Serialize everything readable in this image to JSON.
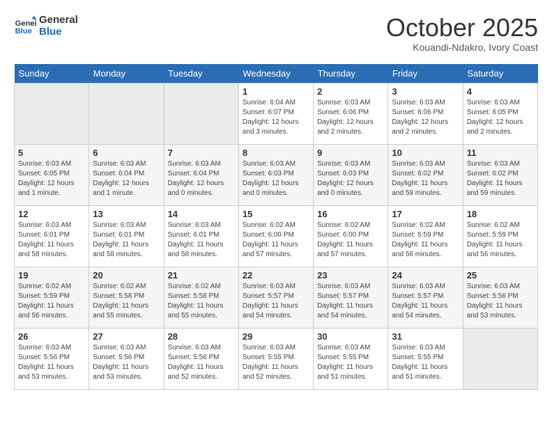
{
  "logo": {
    "line1": "General",
    "line2": "Blue"
  },
  "title": "October 2025",
  "location": "Kouandi-Ndakro, Ivory Coast",
  "days_header": [
    "Sunday",
    "Monday",
    "Tuesday",
    "Wednesday",
    "Thursday",
    "Friday",
    "Saturday"
  ],
  "weeks": [
    [
      {
        "day": "",
        "detail": ""
      },
      {
        "day": "",
        "detail": ""
      },
      {
        "day": "",
        "detail": ""
      },
      {
        "day": "1",
        "detail": "Sunrise: 6:04 AM\nSunset: 6:07 PM\nDaylight: 12 hours\nand 3 minutes."
      },
      {
        "day": "2",
        "detail": "Sunrise: 6:03 AM\nSunset: 6:06 PM\nDaylight: 12 hours\nand 2 minutes."
      },
      {
        "day": "3",
        "detail": "Sunrise: 6:03 AM\nSunset: 6:06 PM\nDaylight: 12 hours\nand 2 minutes."
      },
      {
        "day": "4",
        "detail": "Sunrise: 6:03 AM\nSunset: 6:05 PM\nDaylight: 12 hours\nand 2 minutes."
      }
    ],
    [
      {
        "day": "5",
        "detail": "Sunrise: 6:03 AM\nSunset: 6:05 PM\nDaylight: 12 hours\nand 1 minute."
      },
      {
        "day": "6",
        "detail": "Sunrise: 6:03 AM\nSunset: 6:04 PM\nDaylight: 12 hours\nand 1 minute."
      },
      {
        "day": "7",
        "detail": "Sunrise: 6:03 AM\nSunset: 6:04 PM\nDaylight: 12 hours\nand 0 minutes."
      },
      {
        "day": "8",
        "detail": "Sunrise: 6:03 AM\nSunset: 6:03 PM\nDaylight: 12 hours\nand 0 minutes."
      },
      {
        "day": "9",
        "detail": "Sunrise: 6:03 AM\nSunset: 6:03 PM\nDaylight: 12 hours\nand 0 minutes."
      },
      {
        "day": "10",
        "detail": "Sunrise: 6:03 AM\nSunset: 6:02 PM\nDaylight: 11 hours\nand 59 minutes."
      },
      {
        "day": "11",
        "detail": "Sunrise: 6:03 AM\nSunset: 6:02 PM\nDaylight: 11 hours\nand 59 minutes."
      }
    ],
    [
      {
        "day": "12",
        "detail": "Sunrise: 6:03 AM\nSunset: 6:01 PM\nDaylight: 11 hours\nand 58 minutes."
      },
      {
        "day": "13",
        "detail": "Sunrise: 6:03 AM\nSunset: 6:01 PM\nDaylight: 11 hours\nand 58 minutes."
      },
      {
        "day": "14",
        "detail": "Sunrise: 6:03 AM\nSunset: 6:01 PM\nDaylight: 11 hours\nand 58 minutes."
      },
      {
        "day": "15",
        "detail": "Sunrise: 6:02 AM\nSunset: 6:00 PM\nDaylight: 11 hours\nand 57 minutes."
      },
      {
        "day": "16",
        "detail": "Sunrise: 6:02 AM\nSunset: 6:00 PM\nDaylight: 11 hours\nand 57 minutes."
      },
      {
        "day": "17",
        "detail": "Sunrise: 6:02 AM\nSunset: 5:59 PM\nDaylight: 11 hours\nand 56 minutes."
      },
      {
        "day": "18",
        "detail": "Sunrise: 6:02 AM\nSunset: 5:59 PM\nDaylight: 11 hours\nand 56 minutes."
      }
    ],
    [
      {
        "day": "19",
        "detail": "Sunrise: 6:02 AM\nSunset: 5:59 PM\nDaylight: 11 hours\nand 56 minutes."
      },
      {
        "day": "20",
        "detail": "Sunrise: 6:02 AM\nSunset: 5:58 PM\nDaylight: 11 hours\nand 55 minutes."
      },
      {
        "day": "21",
        "detail": "Sunrise: 6:02 AM\nSunset: 5:58 PM\nDaylight: 11 hours\nand 55 minutes."
      },
      {
        "day": "22",
        "detail": "Sunrise: 6:03 AM\nSunset: 5:57 PM\nDaylight: 11 hours\nand 54 minutes."
      },
      {
        "day": "23",
        "detail": "Sunrise: 6:03 AM\nSunset: 5:57 PM\nDaylight: 11 hours\nand 54 minutes."
      },
      {
        "day": "24",
        "detail": "Sunrise: 6:03 AM\nSunset: 5:57 PM\nDaylight: 11 hours\nand 54 minutes."
      },
      {
        "day": "25",
        "detail": "Sunrise: 6:03 AM\nSunset: 5:56 PM\nDaylight: 11 hours\nand 53 minutes."
      }
    ],
    [
      {
        "day": "26",
        "detail": "Sunrise: 6:03 AM\nSunset: 5:56 PM\nDaylight: 11 hours\nand 53 minutes."
      },
      {
        "day": "27",
        "detail": "Sunrise: 6:03 AM\nSunset: 5:56 PM\nDaylight: 11 hours\nand 53 minutes."
      },
      {
        "day": "28",
        "detail": "Sunrise: 6:03 AM\nSunset: 5:56 PM\nDaylight: 11 hours\nand 52 minutes."
      },
      {
        "day": "29",
        "detail": "Sunrise: 6:03 AM\nSunset: 5:55 PM\nDaylight: 11 hours\nand 52 minutes."
      },
      {
        "day": "30",
        "detail": "Sunrise: 6:03 AM\nSunset: 5:55 PM\nDaylight: 11 hours\nand 51 minutes."
      },
      {
        "day": "31",
        "detail": "Sunrise: 6:03 AM\nSunset: 5:55 PM\nDaylight: 11 hours\nand 51 minutes."
      },
      {
        "day": "",
        "detail": ""
      }
    ]
  ]
}
